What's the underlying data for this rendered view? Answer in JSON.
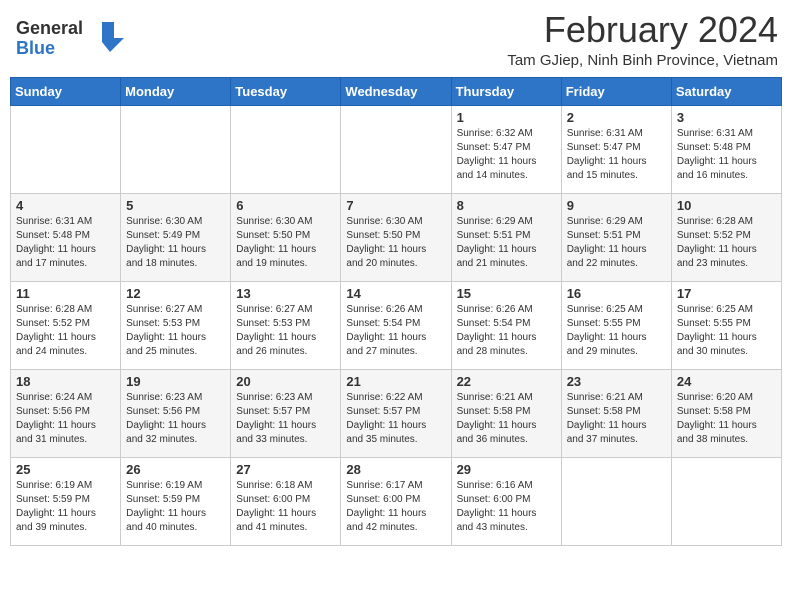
{
  "header": {
    "logo_line1": "General",
    "logo_line2": "Blue",
    "month_title": "February 2024",
    "location": "Tam GJiep, Ninh Binh Province, Vietnam"
  },
  "days_of_week": [
    "Sunday",
    "Monday",
    "Tuesday",
    "Wednesday",
    "Thursday",
    "Friday",
    "Saturday"
  ],
  "weeks": [
    [
      {
        "day": "",
        "info": ""
      },
      {
        "day": "",
        "info": ""
      },
      {
        "day": "",
        "info": ""
      },
      {
        "day": "",
        "info": ""
      },
      {
        "day": "1",
        "info": "Sunrise: 6:32 AM\nSunset: 5:47 PM\nDaylight: 11 hours and 14 minutes."
      },
      {
        "day": "2",
        "info": "Sunrise: 6:31 AM\nSunset: 5:47 PM\nDaylight: 11 hours and 15 minutes."
      },
      {
        "day": "3",
        "info": "Sunrise: 6:31 AM\nSunset: 5:48 PM\nDaylight: 11 hours and 16 minutes."
      }
    ],
    [
      {
        "day": "4",
        "info": "Sunrise: 6:31 AM\nSunset: 5:48 PM\nDaylight: 11 hours and 17 minutes."
      },
      {
        "day": "5",
        "info": "Sunrise: 6:30 AM\nSunset: 5:49 PM\nDaylight: 11 hours and 18 minutes."
      },
      {
        "day": "6",
        "info": "Sunrise: 6:30 AM\nSunset: 5:50 PM\nDaylight: 11 hours and 19 minutes."
      },
      {
        "day": "7",
        "info": "Sunrise: 6:30 AM\nSunset: 5:50 PM\nDaylight: 11 hours and 20 minutes."
      },
      {
        "day": "8",
        "info": "Sunrise: 6:29 AM\nSunset: 5:51 PM\nDaylight: 11 hours and 21 minutes."
      },
      {
        "day": "9",
        "info": "Sunrise: 6:29 AM\nSunset: 5:51 PM\nDaylight: 11 hours and 22 minutes."
      },
      {
        "day": "10",
        "info": "Sunrise: 6:28 AM\nSunset: 5:52 PM\nDaylight: 11 hours and 23 minutes."
      }
    ],
    [
      {
        "day": "11",
        "info": "Sunrise: 6:28 AM\nSunset: 5:52 PM\nDaylight: 11 hours and 24 minutes."
      },
      {
        "day": "12",
        "info": "Sunrise: 6:27 AM\nSunset: 5:53 PM\nDaylight: 11 hours and 25 minutes."
      },
      {
        "day": "13",
        "info": "Sunrise: 6:27 AM\nSunset: 5:53 PM\nDaylight: 11 hours and 26 minutes."
      },
      {
        "day": "14",
        "info": "Sunrise: 6:26 AM\nSunset: 5:54 PM\nDaylight: 11 hours and 27 minutes."
      },
      {
        "day": "15",
        "info": "Sunrise: 6:26 AM\nSunset: 5:54 PM\nDaylight: 11 hours and 28 minutes."
      },
      {
        "day": "16",
        "info": "Sunrise: 6:25 AM\nSunset: 5:55 PM\nDaylight: 11 hours and 29 minutes."
      },
      {
        "day": "17",
        "info": "Sunrise: 6:25 AM\nSunset: 5:55 PM\nDaylight: 11 hours and 30 minutes."
      }
    ],
    [
      {
        "day": "18",
        "info": "Sunrise: 6:24 AM\nSunset: 5:56 PM\nDaylight: 11 hours and 31 minutes."
      },
      {
        "day": "19",
        "info": "Sunrise: 6:23 AM\nSunset: 5:56 PM\nDaylight: 11 hours and 32 minutes."
      },
      {
        "day": "20",
        "info": "Sunrise: 6:23 AM\nSunset: 5:57 PM\nDaylight: 11 hours and 33 minutes."
      },
      {
        "day": "21",
        "info": "Sunrise: 6:22 AM\nSunset: 5:57 PM\nDaylight: 11 hours and 35 minutes."
      },
      {
        "day": "22",
        "info": "Sunrise: 6:21 AM\nSunset: 5:58 PM\nDaylight: 11 hours and 36 minutes."
      },
      {
        "day": "23",
        "info": "Sunrise: 6:21 AM\nSunset: 5:58 PM\nDaylight: 11 hours and 37 minutes."
      },
      {
        "day": "24",
        "info": "Sunrise: 6:20 AM\nSunset: 5:58 PM\nDaylight: 11 hours and 38 minutes."
      }
    ],
    [
      {
        "day": "25",
        "info": "Sunrise: 6:19 AM\nSunset: 5:59 PM\nDaylight: 11 hours and 39 minutes."
      },
      {
        "day": "26",
        "info": "Sunrise: 6:19 AM\nSunset: 5:59 PM\nDaylight: 11 hours and 40 minutes."
      },
      {
        "day": "27",
        "info": "Sunrise: 6:18 AM\nSunset: 6:00 PM\nDaylight: 11 hours and 41 minutes."
      },
      {
        "day": "28",
        "info": "Sunrise: 6:17 AM\nSunset: 6:00 PM\nDaylight: 11 hours and 42 minutes."
      },
      {
        "day": "29",
        "info": "Sunrise: 6:16 AM\nSunset: 6:00 PM\nDaylight: 11 hours and 43 minutes."
      },
      {
        "day": "",
        "info": ""
      },
      {
        "day": "",
        "info": ""
      }
    ]
  ]
}
